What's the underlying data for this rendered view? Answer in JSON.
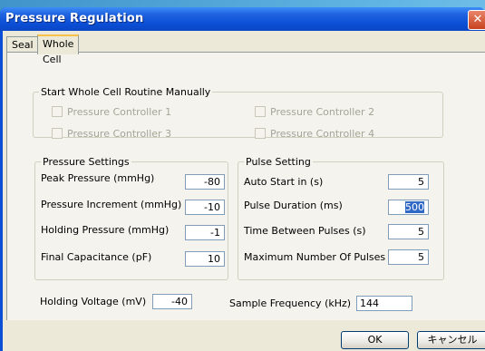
{
  "window": {
    "title": "Pressure Regulation",
    "close_glyph": "✕"
  },
  "tabs": [
    {
      "label": "Seal"
    },
    {
      "label": "Whole Cell"
    }
  ],
  "manual_group": {
    "legend": "Start Whole Cell Routine Manually",
    "controllers": [
      {
        "label": "Pressure Controller 1"
      },
      {
        "label": "Pressure Controller 2"
      },
      {
        "label": "Pressure Controller 3"
      },
      {
        "label": "Pressure Controller 4"
      }
    ]
  },
  "pressure_settings": {
    "legend": "Pressure Settings",
    "rows": [
      {
        "label": "Peak Pressure (mmHg)",
        "value": "-80"
      },
      {
        "label": "Pressure Increment (mmHg)",
        "value": "-10"
      },
      {
        "label": "Holding Pressure (mmHg)",
        "value": "-1"
      },
      {
        "label": "Final Capacitance (pF)",
        "value": "10"
      }
    ]
  },
  "pulse_setting": {
    "legend": "Pulse Setting",
    "rows": [
      {
        "label": "Auto Start in (s)",
        "value": "5"
      },
      {
        "label": "Pulse Duration (ms)",
        "value": "500"
      },
      {
        "label": "Time Between Pulses (s)",
        "value": "5"
      },
      {
        "label": "Maximum Number Of Pulses",
        "value": "5"
      }
    ]
  },
  "holding_voltage": {
    "label": "Holding Voltage (mV)",
    "value": "-40"
  },
  "sample_frequency": {
    "label": "Sample Frequency (kHz)",
    "value": "144"
  },
  "buttons": {
    "ok": "OK",
    "cancel": "キャンセル"
  },
  "colors": {
    "titlebar": "#0b4fd6",
    "dialog_bg": "#ece9d8",
    "selection": "#316ac5"
  }
}
